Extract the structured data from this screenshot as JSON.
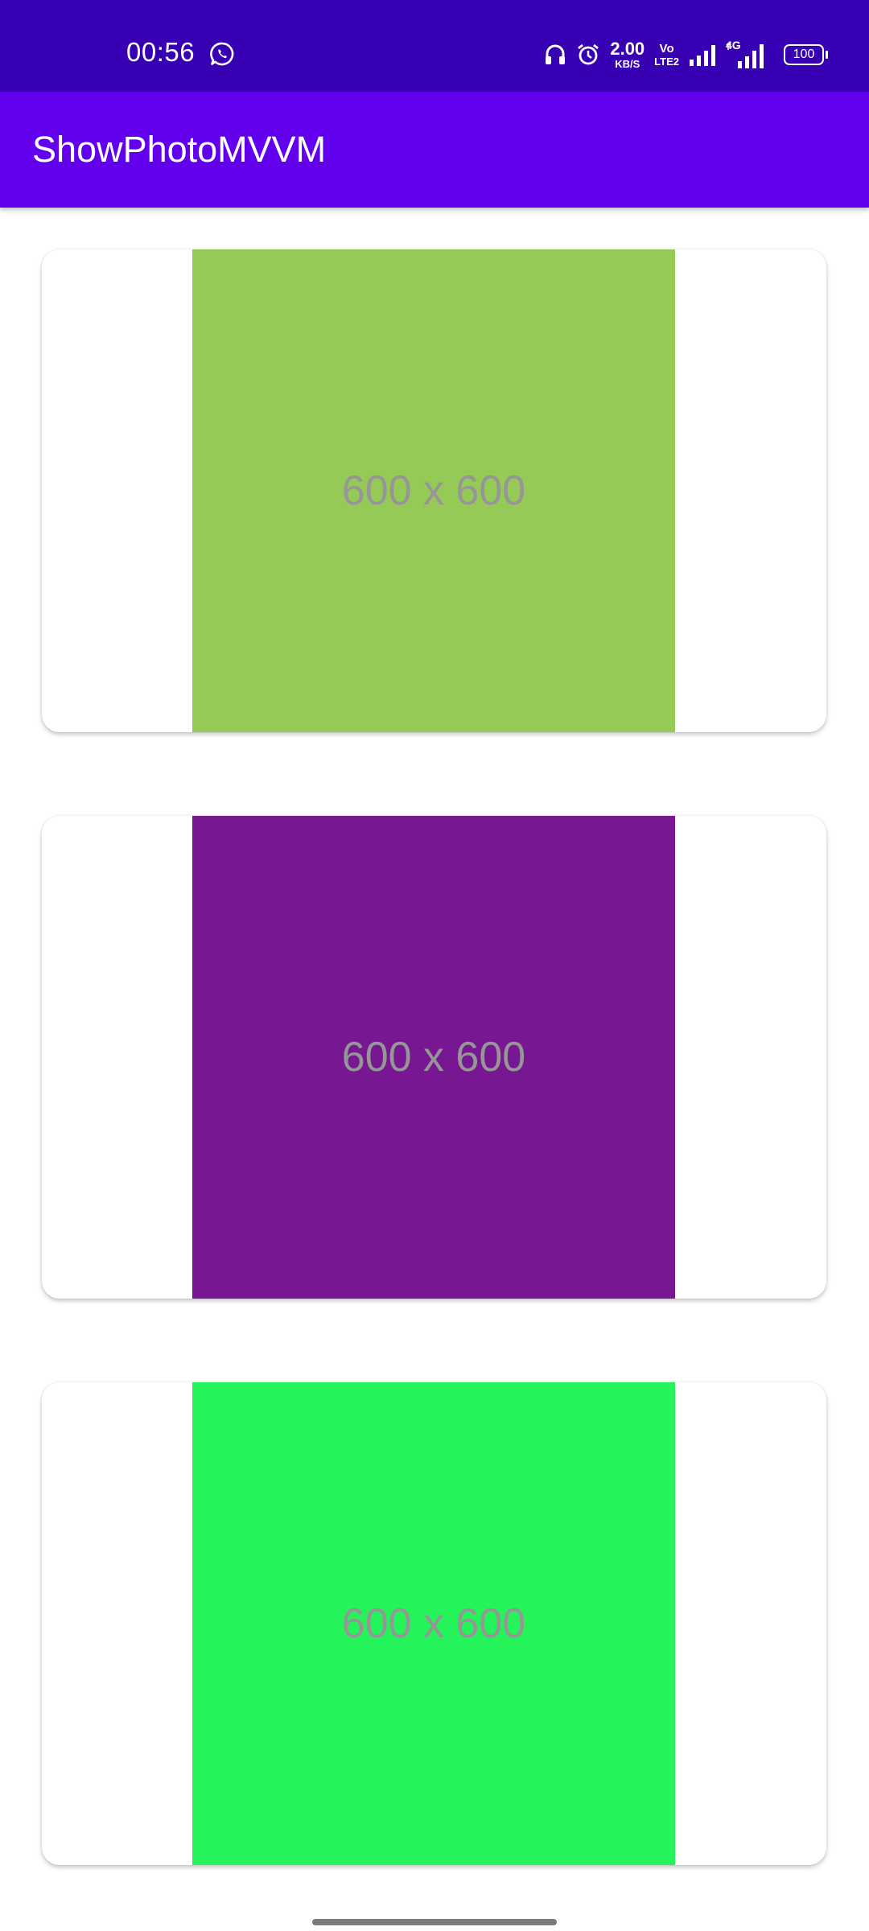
{
  "status_bar": {
    "time": "00:56",
    "net_speed_value": "2.00",
    "net_speed_unit": "KB/S",
    "volte_top": "Vo",
    "volte_bottom": "LTE2",
    "network_type": "4G",
    "battery_level": "100",
    "colors": {
      "background": "#3700b3"
    }
  },
  "app_bar": {
    "title": "ShowPhotoMVVM",
    "color": "#6200ee"
  },
  "photos": [
    {
      "label": "600 x 600",
      "color": "#96ca56"
    },
    {
      "label": "600 x 600",
      "color": "#771791"
    },
    {
      "label": "600 x 600",
      "color": "#24f459"
    }
  ],
  "icons": [
    "whatsapp-icon",
    "headphones-icon",
    "alarm-icon",
    "signal-icon",
    "signal-icon",
    "battery-icon"
  ]
}
